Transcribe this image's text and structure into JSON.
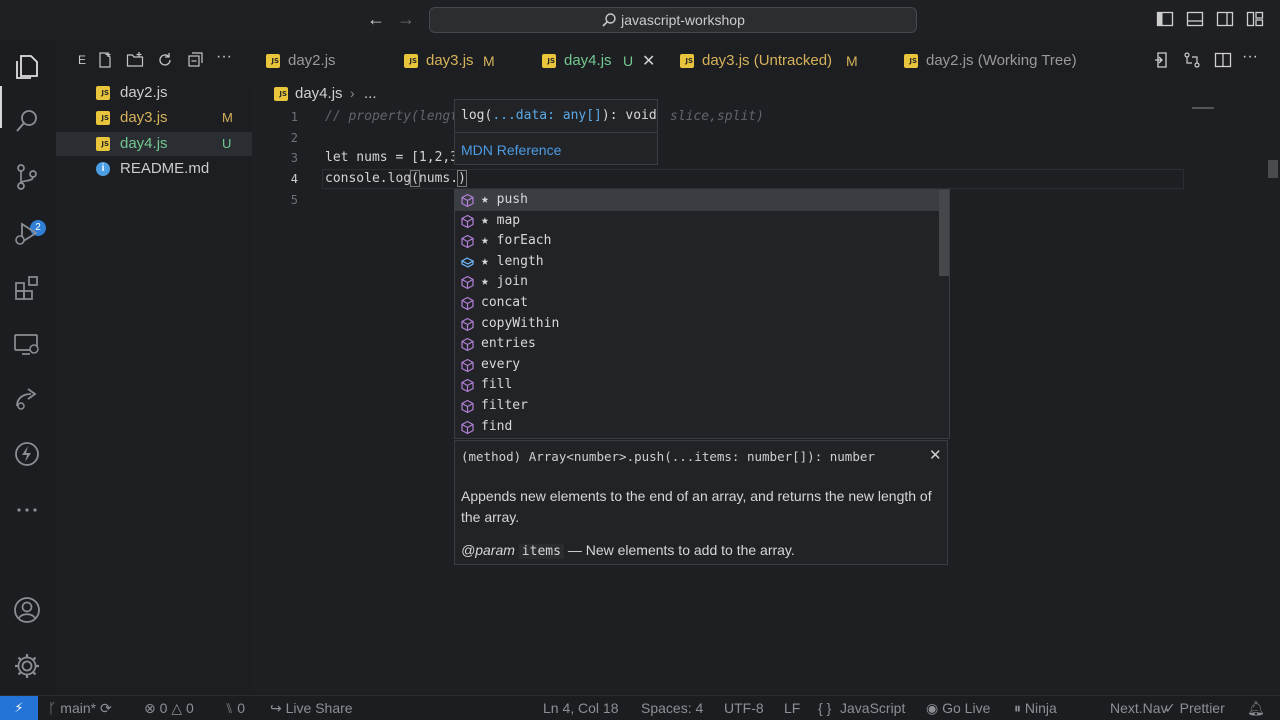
{
  "titlebar": {
    "search_text": "javascript-workshop"
  },
  "activitybar": {
    "scm_badge": "2"
  },
  "sidebar": {
    "title": "E",
    "files": [
      {
        "name": "day2.js",
        "status": "",
        "type": "js"
      },
      {
        "name": "day3.js",
        "status": "M",
        "type": "js"
      },
      {
        "name": "day4.js",
        "status": "U",
        "type": "js",
        "active": true
      },
      {
        "name": "README.md",
        "status": "",
        "type": "info"
      }
    ]
  },
  "tabs": [
    {
      "label": "day2.js",
      "status": ""
    },
    {
      "label": "day3.js",
      "status": "M"
    },
    {
      "label": "day4.js",
      "status": "U",
      "active": true,
      "close": "✕"
    },
    {
      "label": "day3.js (Untracked)",
      "status": "M"
    },
    {
      "label": "day2.js (Working Tree)",
      "status": ""
    }
  ],
  "breadcrumb": {
    "file": "day4.js",
    "sep": "›",
    "more": "..."
  },
  "editor": {
    "line_numbers": [
      "1",
      "2",
      "3",
      "4",
      "5"
    ],
    "line1": "// property(lengt",
    "line1_tail": "slice,split)",
    "line3": {
      "kw": "let",
      "rest": " nums = [1,2,3"
    },
    "line4": {
      "obj": "console",
      "dot": ".",
      "fn": "log",
      "open": "(",
      "arg": "nums.",
      "close": ")"
    }
  },
  "param_hint": {
    "sig_fn": "log(",
    "sig_param": "...data: any[]",
    "sig_rest": "): void",
    "link": "MDN Reference"
  },
  "suggestions": [
    {
      "label": "★ push",
      "kind": "method",
      "selected": true
    },
    {
      "label": "★ map",
      "kind": "method"
    },
    {
      "label": "★ forEach",
      "kind": "method"
    },
    {
      "label": "★ length",
      "kind": "property"
    },
    {
      "label": "★ join",
      "kind": "method"
    },
    {
      "label": "concat",
      "kind": "method"
    },
    {
      "label": "copyWithin",
      "kind": "method"
    },
    {
      "label": "entries",
      "kind": "method"
    },
    {
      "label": "every",
      "kind": "method"
    },
    {
      "label": "fill",
      "kind": "method"
    },
    {
      "label": "filter",
      "kind": "method"
    },
    {
      "label": "find",
      "kind": "method"
    }
  ],
  "details": {
    "signature": "(method) Array<number>.push(...items: number[]): number",
    "close": "✕",
    "description": "Appends new elements to the end of an array, and returns the new length of the array.",
    "param_tag": "@param",
    "param_name": "items",
    "param_desc": " — New elements to add to the array."
  },
  "statusbar": {
    "remote": "⚡",
    "branch": "main*",
    "errors": "0",
    "warnings": "0",
    "ports": "0",
    "live_share": "Live Share",
    "cursor": "Ln 4, Col 18",
    "spaces": "Spaces: 4",
    "encoding": "UTF-8",
    "eol": "LF",
    "braces": "{ }",
    "language": "JavaScript",
    "go_live": "Go Live",
    "ninja": "Ninja",
    "next_nav": "Next.Nav",
    "prettier": "Prettier"
  },
  "colors": {
    "accent": "#2473d6",
    "modified": "#d6b35a",
    "untracked": "#73c991",
    "link": "#4d9ce6",
    "method_icon": "#b180d7",
    "property_icon": "#75beff"
  }
}
